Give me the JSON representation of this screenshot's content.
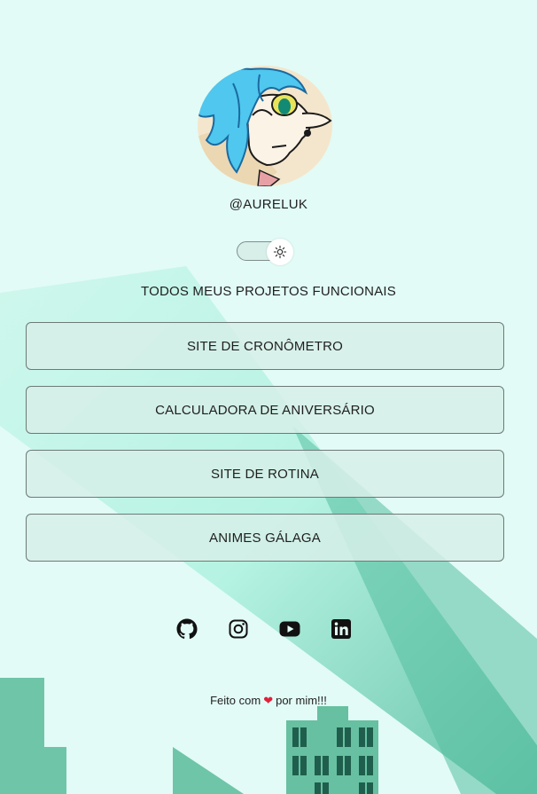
{
  "profile": {
    "handle": "@AURELUK"
  },
  "theme_toggle": {
    "mode": "light",
    "icon": "sun-icon"
  },
  "section_title": "TODOS MEUS PROJETOS FUNCIONAIS",
  "links": [
    {
      "label": "SITE DE CRONÔMETRO"
    },
    {
      "label": "CALCULADORA DE ANIVERSÁRIO"
    },
    {
      "label": "SITE DE ROTINA"
    },
    {
      "label": "ANIMES GÁLAGA"
    }
  ],
  "social": [
    "github-icon",
    "instagram-icon",
    "youtube-icon",
    "linkedin-icon"
  ],
  "footer": {
    "before": "Feito com",
    "heart": "❤",
    "after": "por mim!!!"
  },
  "colors": {
    "background": "#e2fbf6",
    "button_bg": "#d6eee8",
    "button_border": "#6e7a77",
    "heart": "#e01f3a"
  }
}
